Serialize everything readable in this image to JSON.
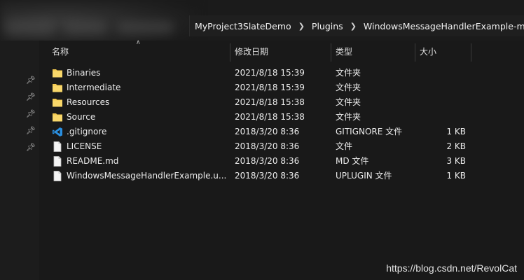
{
  "breadcrumb": {
    "items": [
      "MyProject3SlateDemo",
      "Plugins",
      "WindowsMessageHandlerExample-master"
    ]
  },
  "columns": {
    "name": "名称",
    "date": "修改日期",
    "type": "类型",
    "size": "大小"
  },
  "files": [
    {
      "name": "Binaries",
      "date": "2021/8/18 15:39",
      "type": "文件夹",
      "size": "",
      "icon": "folder-icon"
    },
    {
      "name": "Intermediate",
      "date": "2021/8/18 15:39",
      "type": "文件夹",
      "size": "",
      "icon": "folder-icon"
    },
    {
      "name": "Resources",
      "date": "2021/8/18 15:38",
      "type": "文件夹",
      "size": "",
      "icon": "folder-icon"
    },
    {
      "name": "Source",
      "date": "2021/8/18 15:38",
      "type": "文件夹",
      "size": "",
      "icon": "folder-icon"
    },
    {
      "name": ".gitignore",
      "date": "2018/3/20 8:36",
      "type": "GITIGNORE 文件",
      "size": "1 KB",
      "icon": "vscode-icon"
    },
    {
      "name": "LICENSE",
      "date": "2018/3/20 8:36",
      "type": "文件",
      "size": "2 KB",
      "icon": "file-icon"
    },
    {
      "name": "README.md",
      "date": "2018/3/20 8:36",
      "type": "MD 文件",
      "size": "3 KB",
      "icon": "file-icon"
    },
    {
      "name": "WindowsMessageHandlerExample.u...",
      "date": "2018/3/20 8:36",
      "type": "UPLUGIN 文件",
      "size": "1 KB",
      "icon": "file-icon"
    }
  ],
  "watermark": "https://blog.csdn.net/RevolCat",
  "colors": {
    "folder": "#f3c94f",
    "vscode": "#2a8fe0",
    "background": "#191919"
  }
}
